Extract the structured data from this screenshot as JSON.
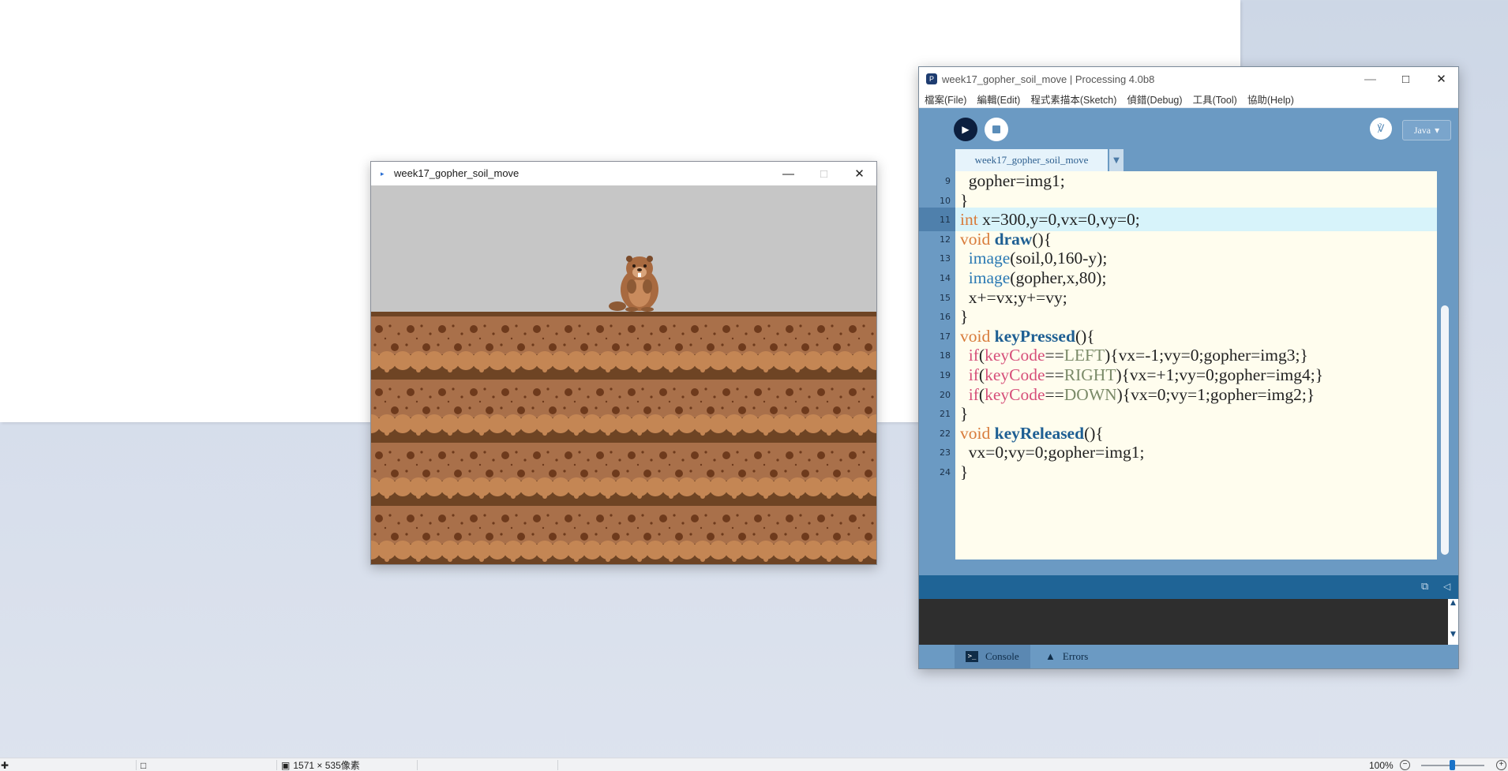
{
  "sketch_window": {
    "title": "week17_gopher_soil_move"
  },
  "ide_window": {
    "title": "week17_gopher_soil_move | Processing 4.0b8",
    "menu": [
      "檔案(File)",
      "編輯(Edit)",
      "程式素描本(Sketch)",
      "偵錯(Debug)",
      "工具(Tool)",
      "協助(Help)"
    ],
    "mode": "Java",
    "tab_label": "week17_gopher_soil_move",
    "console_tab": "Console",
    "errors_tab": "Errors",
    "code": [
      {
        "n": "9",
        "text": "  gopher=img1;"
      },
      {
        "n": "10",
        "text": "}"
      },
      {
        "n": "11",
        "text": "int x=300,y=0,vx=0,vy=0;"
      },
      {
        "n": "12",
        "text": "void draw(){"
      },
      {
        "n": "13",
        "text": "  image(soil,0,160-y);"
      },
      {
        "n": "14",
        "text": "  image(gopher,x,80);"
      },
      {
        "n": "15",
        "text": "  x+=vx;y+=vy;"
      },
      {
        "n": "16",
        "text": "}"
      },
      {
        "n": "17",
        "text": "void keyPressed(){"
      },
      {
        "n": "18",
        "text": "  if(keyCode==LEFT){vx=-1;vy=0;gopher=img3;}"
      },
      {
        "n": "19",
        "text": "  if(keyCode==RIGHT){vx=+1;vy=0;gopher=img4;}"
      },
      {
        "n": "20",
        "text": "  if(keyCode==DOWN){vx=0;vy=1;gopher=img2;}"
      },
      {
        "n": "21",
        "text": "}"
      },
      {
        "n": "22",
        "text": "void keyReleased(){"
      },
      {
        "n": "23",
        "text": "  vx=0;vy=0;gopher=img1;"
      },
      {
        "n": "24",
        "text": "}"
      }
    ],
    "active_line": "11"
  },
  "statusbar": {
    "dimensions": "1571 × 535像素",
    "zoom": "100%"
  },
  "colors": {
    "ide_blue": "#6b9ac3",
    "editor_bg": "#fffdee",
    "active_line": "#d7f3fa",
    "sky": "#c6c6c6",
    "soil": "#a86c44"
  }
}
